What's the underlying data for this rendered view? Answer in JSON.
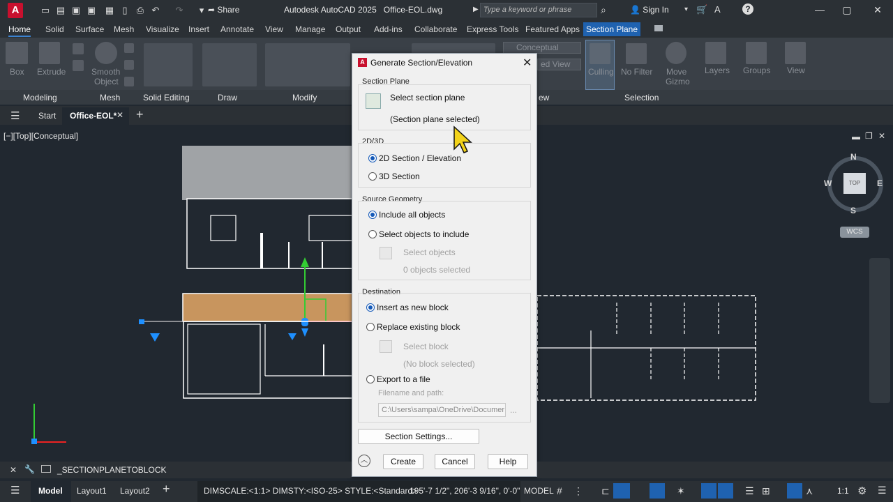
{
  "titlebar": {
    "app_title": "Autodesk AutoCAD 2025",
    "file_name": "Office-EOL.dwg",
    "share_label": "Share",
    "search_placeholder": "Type a keyword or phrase",
    "sign_in": "Sign In"
  },
  "menu_tabs": [
    "Home",
    "Solid",
    "Surface",
    "Mesh",
    "Visualize",
    "Insert",
    "Annotate",
    "View",
    "Manage",
    "Output",
    "Add-ins",
    "Collaborate",
    "Express Tools",
    "Featured Apps",
    "Section Plane"
  ],
  "ribbon": {
    "tools": {
      "box": "Box",
      "extrude": "Extrude",
      "smooth_object_1": "Smooth",
      "smooth_object_2": "Object",
      "conceptual": "Conceptual",
      "view_dropdown": "ed View",
      "culling": "Culling",
      "no_filter": "No Filter",
      "move_gizmo_1": "Move",
      "move_gizmo_2": "Gizmo",
      "layers": "Layers",
      "groups": "Groups",
      "view": "View"
    },
    "panels": {
      "modeling": "Modeling",
      "mesh": "Mesh",
      "solid_editing": "Solid Editing",
      "draw": "Draw",
      "modify": "Modify",
      "view_panel": "ew",
      "selection": "Selection"
    }
  },
  "file_tabs": {
    "start": "Start",
    "active": "Office-EOL*"
  },
  "viewport": {
    "label": "[−][Top][Conceptual]",
    "viewcube": {
      "n": "N",
      "s": "S",
      "e": "E",
      "w": "W",
      "top": "TOP",
      "wcs": "WCS"
    }
  },
  "dialog": {
    "title": "Generate Section/Elevation",
    "section_plane": {
      "group": "Section Plane",
      "select_label": "Select section plane",
      "status": "(Section plane selected)"
    },
    "dimension": {
      "group": "2D/3D",
      "opt_2d": "2D Section / Elevation",
      "opt_3d": "3D Section",
      "selected": "2D Section / Elevation"
    },
    "source": {
      "group": "Source Geometry",
      "opt_all": "Include all objects",
      "opt_select": "Select objects to include",
      "select_objects": "Select objects",
      "count": "0 objects selected",
      "selected": "Include all objects"
    },
    "destination": {
      "group": "Destination",
      "opt_new": "Insert as new block",
      "opt_replace": "Replace existing block",
      "select_block": "Select block",
      "block_status": "(No block selected)",
      "opt_export": "Export to a file",
      "filename_label": "Filename and path:",
      "filename_value": "C:\\Users\\sampa\\OneDrive\\Documer",
      "browse": "...",
      "selected": "Insert as new block"
    },
    "buttons": {
      "settings": "Section Settings...",
      "create": "Create",
      "cancel": "Cancel",
      "help": "Help"
    }
  },
  "command_line": {
    "text": "_SECTIONPLANETOBLOCK"
  },
  "status_bar": {
    "model_tab": "Model",
    "layout1": "Layout1",
    "layout2": "Layout2",
    "dims": "DIMSCALE:<1:1> DIMSTY:<ISO-25> STYLE:<Standard>",
    "coords": "195'-7 1/2\", 206'-3 9/16\", 0'-0\"",
    "space": "MODEL",
    "scale": "1:1"
  },
  "colors": {
    "accent": "#1f62b0",
    "cad_bg": "#212830",
    "section_fill": "#c8955e",
    "dialog_bg": "#f0f0f0"
  }
}
